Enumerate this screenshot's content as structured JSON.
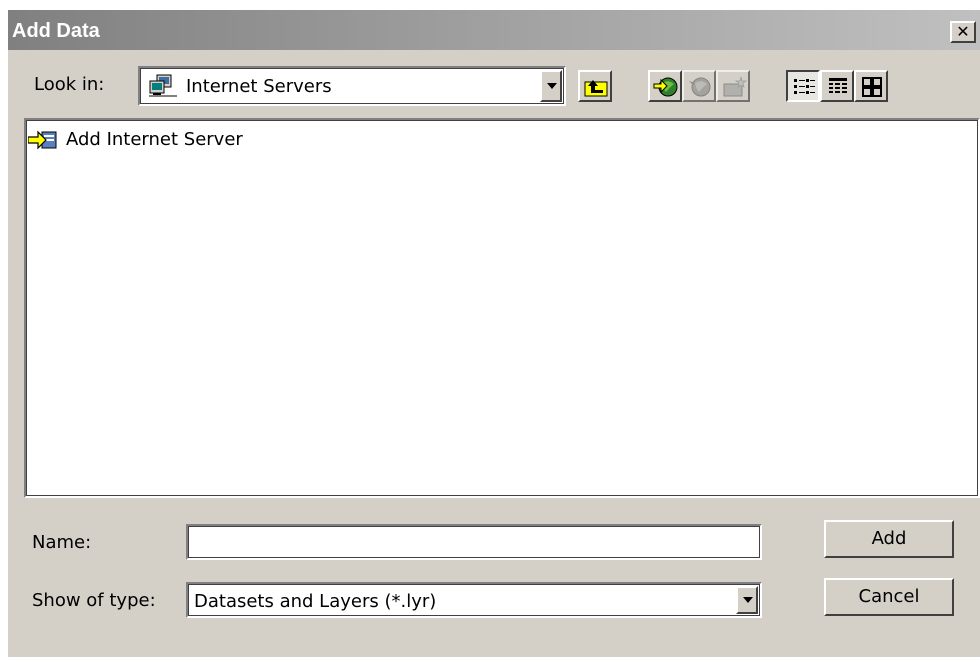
{
  "window": {
    "title": "Add Data",
    "close_glyph": "✕"
  },
  "toolbar": {
    "look_in_label": "Look in:",
    "look_in_value": "Internet Servers",
    "look_in_icon": "network-servers-icon",
    "buttons": [
      {
        "name": "up-one-level-button",
        "icon": "folder-up-arrow-icon",
        "pressed": false,
        "enabled": true
      },
      {
        "name": "connect-to-server-button",
        "icon": "globe-arrow-icon",
        "pressed": false,
        "enabled": true
      },
      {
        "name": "disconnect-button",
        "icon": "globe-disconnect-icon",
        "pressed": false,
        "enabled": false
      },
      {
        "name": "new-item-button",
        "icon": "new-folder-icon",
        "pressed": false,
        "enabled": false
      },
      {
        "name": "list-view-button",
        "icon": "list-view-icon",
        "pressed": true,
        "enabled": true
      },
      {
        "name": "details-view-button",
        "icon": "details-view-icon",
        "pressed": false,
        "enabled": true
      },
      {
        "name": "thumbnails-view-button",
        "icon": "thumbnails-view-icon",
        "pressed": false,
        "enabled": true
      }
    ]
  },
  "file_list": {
    "items": [
      {
        "label": "Add Internet Server",
        "icon": "add-server-icon"
      }
    ]
  },
  "form": {
    "name_label": "Name:",
    "name_value": "",
    "type_label": "Show of type:",
    "type_value": "Datasets and Layers (*.lyr)"
  },
  "actions": {
    "add_label": "Add",
    "cancel_label": "Cancel"
  },
  "colors": {
    "dialog_face": "#d4d0c8",
    "title_gradient_start": "#808080",
    "title_gradient_end": "#c0c0c0",
    "icon_yellow": "#ffff00"
  }
}
